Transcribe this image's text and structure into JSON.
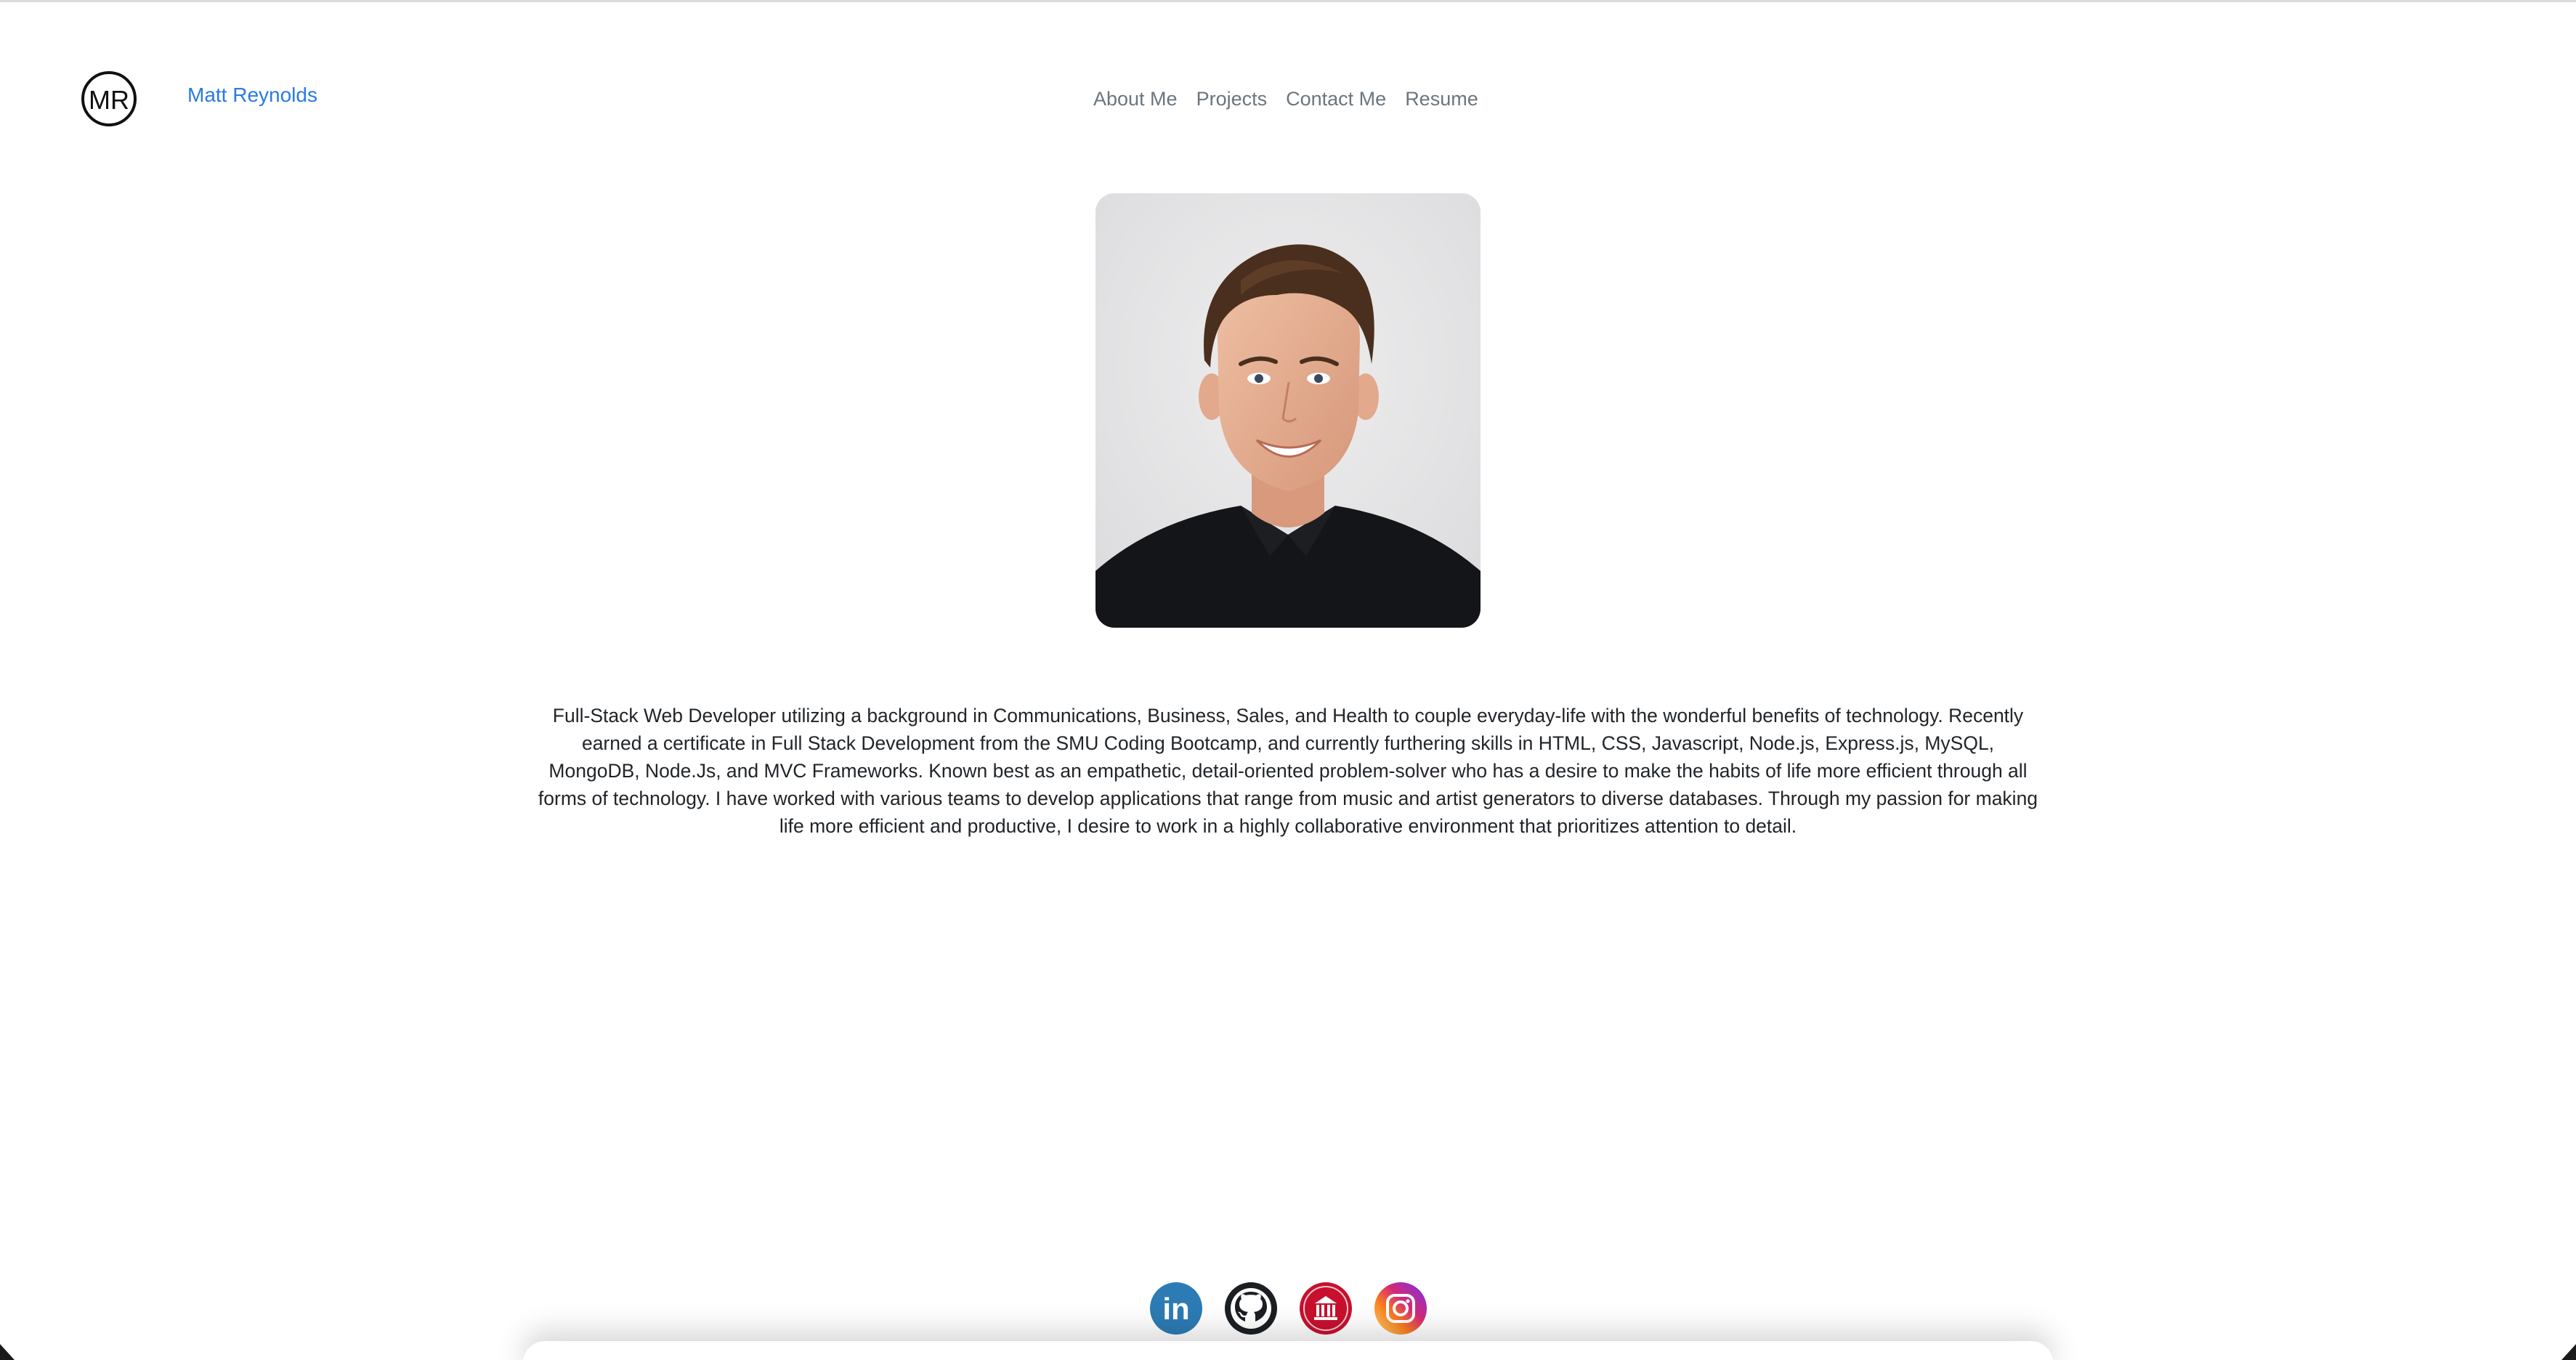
{
  "header": {
    "logo_text": "MR",
    "brand_name": "Matt Reynolds",
    "brand_color": "#2a7ae2"
  },
  "nav": {
    "items": [
      {
        "label": "About Me"
      },
      {
        "label": "Projects"
      },
      {
        "label": "Contact Me"
      },
      {
        "label": "Resume"
      }
    ]
  },
  "profile": {
    "photo_icon": "profile-photo"
  },
  "about": {
    "bio": "Full-Stack Web Developer utilizing a background in Communications, Business, Sales, and Health to couple everyday-life with the wonderful benefits of technology. Recently earned a certificate in Full Stack Development from the SMU Coding Bootcamp, and currently furthering skills in HTML, CSS, Javascript, Node.js, Express.js, MySQL, MongoDB, Node.Js, and MVC Frameworks. Known best as an empathetic, detail-oriented problem-solver who has a desire to make the habits of life more efficient through all forms of technology. I have worked with various teams to develop applications that range from music and artist generators to diverse databases. Through my passion for making life more efficient and productive, I desire to work in a highly collaborative environment that prioritizes attention to detail."
  },
  "footer": {
    "socials": [
      {
        "icon": "linkedin-icon",
        "label": "in",
        "color": "#2d7bb5"
      },
      {
        "icon": "github-icon",
        "color": "#1b1f23"
      },
      {
        "icon": "smu-icon",
        "color": "#c8102e"
      },
      {
        "icon": "instagram-icon",
        "color": "#d62976"
      }
    ]
  }
}
